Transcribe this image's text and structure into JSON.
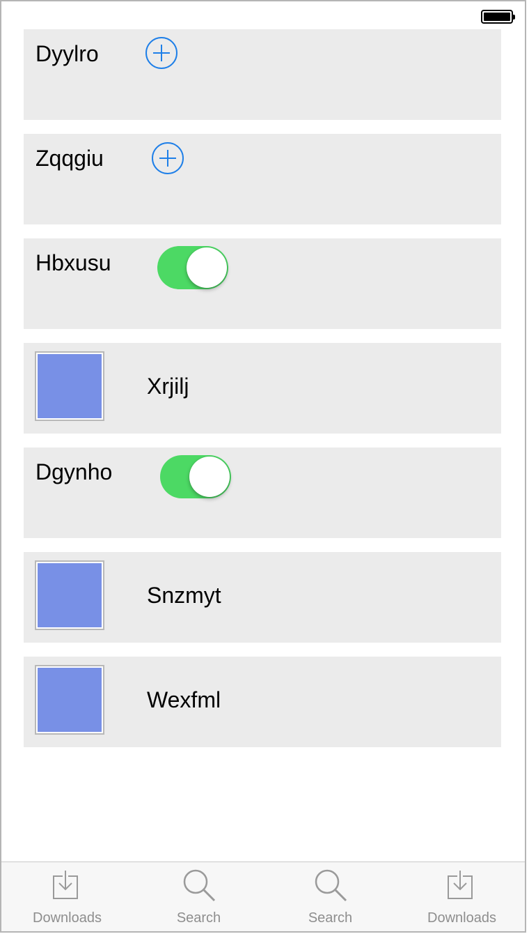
{
  "status_bar": {
    "battery_icon": "battery-full-icon"
  },
  "rows": [
    {
      "type": "plus",
      "label": "Dyylro",
      "icon": "plus-circle-icon"
    },
    {
      "type": "plus",
      "label": "Zqqgiu",
      "icon": "plus-circle-icon"
    },
    {
      "type": "toggle",
      "label": "Hbxusu",
      "on": true,
      "color": "#4cd964"
    },
    {
      "type": "image",
      "label": "Xrjilj",
      "swatch_color": "#7890e6"
    },
    {
      "type": "toggle",
      "label": "Dgynho",
      "on": true,
      "color": "#4cd964"
    },
    {
      "type": "image",
      "label": "Snzmyt",
      "swatch_color": "#7890e6"
    },
    {
      "type": "image",
      "label": "Wexfml",
      "swatch_color": "#7890e6"
    }
  ],
  "tabbar": {
    "tabs": [
      {
        "label": "Downloads",
        "icon": "download-icon"
      },
      {
        "label": "Search",
        "icon": "search-icon"
      },
      {
        "label": "Search",
        "icon": "search-icon"
      },
      {
        "label": "Downloads",
        "icon": "download-icon"
      }
    ]
  },
  "colors": {
    "accent": "#1e7fe8",
    "toggle_on": "#4cd964",
    "row_background": "#ebebeb",
    "tab_inactive": "#8e8e8e"
  }
}
